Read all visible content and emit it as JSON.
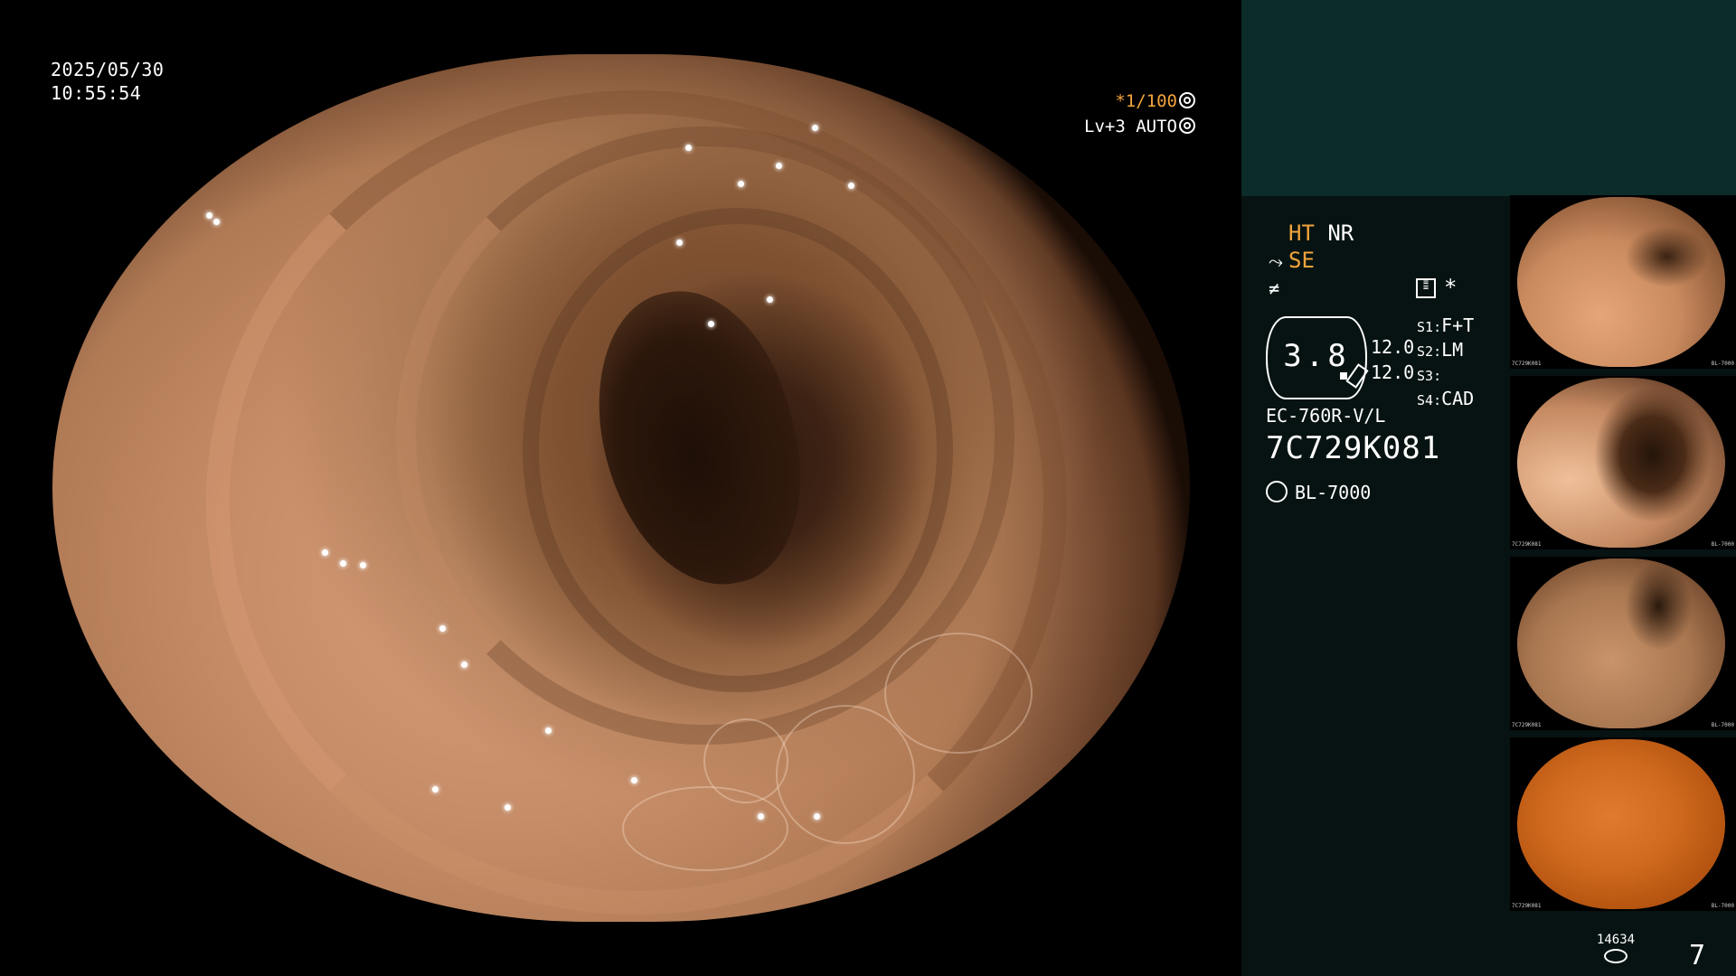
{
  "overlay": {
    "date": "2025/05/30",
    "time": "10:55:54",
    "shutter_star": "*",
    "shutter_speed": "1/100",
    "level": "Lv+3",
    "exposure_mode": "AUTO"
  },
  "panel": {
    "mode_ht": "HT",
    "mode_nr": "NR",
    "mode_se": "SE",
    "extra_asterisk": "*",
    "zoom_value": "3.8",
    "level_1": "12.0",
    "level_2": "12.0",
    "switches": [
      {
        "key": "S1",
        "value": "F+T"
      },
      {
        "key": "S2",
        "value": "LM"
      },
      {
        "key": "S3",
        "value": ""
      },
      {
        "key": "S4",
        "value": "CAD"
      }
    ],
    "scope_model": "EC-760R-V/L",
    "scope_serial": "7C729K081",
    "light_source": "BL-7000"
  },
  "thumbnails": [
    {
      "serial": "7C729K081",
      "light": "BL-7000"
    },
    {
      "serial": "7C729K081",
      "light": "BL-7000"
    },
    {
      "serial": "7C729K081",
      "light": "BL-7000"
    },
    {
      "serial": "7C729K081",
      "light": "BL-7000"
    }
  ],
  "storage_count": "14634",
  "capture_count": "7",
  "colors": {
    "accent_orange": "#f2a43c",
    "panel_bg": "#071312",
    "panel_top": "#0c2c2a"
  },
  "icons": [
    "shutter-icon",
    "auto-exposure-icon",
    "structure-enhance-icon",
    "color-enhance-icon",
    "menu-icon",
    "light-source-icon",
    "storage-icon"
  ]
}
